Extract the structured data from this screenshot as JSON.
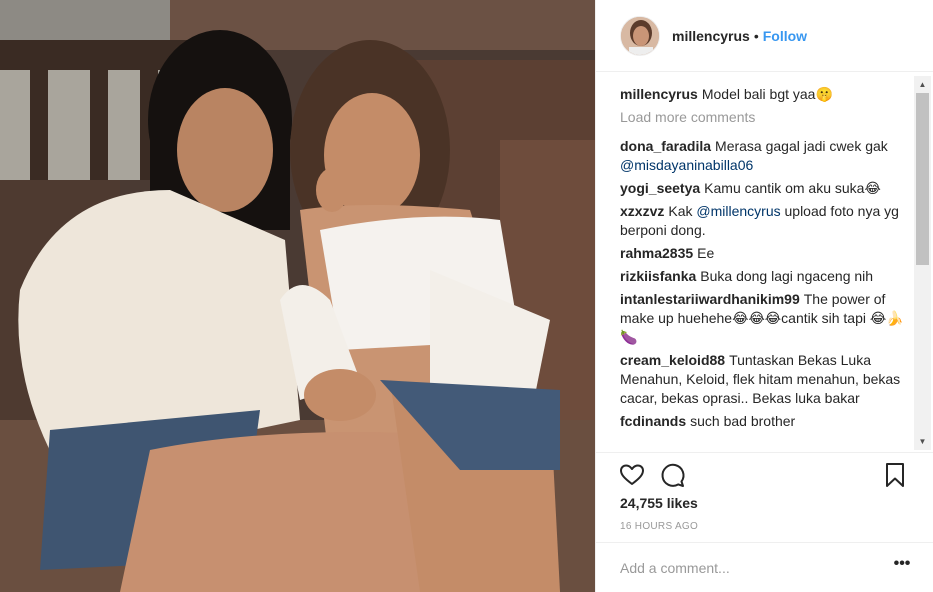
{
  "post": {
    "username": "millencyrus",
    "follow_label": "Follow",
    "separator": "•"
  },
  "caption": {
    "user": "millencyrus",
    "text": "Model bali bgt yaa🤫"
  },
  "load_more_label": "Load more comments",
  "comments": [
    {
      "user": "dona_faradila",
      "text": "Merasa gagal jadi cwek gak",
      "mention": "@misdayaninabilla06",
      "text_after": ""
    },
    {
      "user": "yogi_seetya",
      "text": "Kamu cantik om aku suka😂",
      "mention": "",
      "text_after": ""
    },
    {
      "user": "xzxzvz",
      "text": "Kak",
      "mention": "@millencyrus",
      "text_after": " upload foto nya yg berponi dong."
    },
    {
      "user": "rahma2835",
      "text": "Ee",
      "mention": "",
      "text_after": ""
    },
    {
      "user": "rizkiisfanka",
      "text": "Buka dong lagi ngaceng nih",
      "mention": "",
      "text_after": ""
    },
    {
      "user": "intanlestariiwardhanikim99",
      "text": "The power of make up huehehe😂😂😂cantik sih tapi 😂🍌🍆",
      "mention": "",
      "text_after": ""
    },
    {
      "user": "cream_keloid88",
      "text": "Tuntaskan Bekas Luka Menahun, Keloid, flek hitam menahun, bekas cacar, bekas oprasi.. Bekas luka bakar",
      "mention": "",
      "text_after": ""
    },
    {
      "user": "fcdinands",
      "text": "such bad brother",
      "mention": "",
      "text_after": ""
    }
  ],
  "likes_text": "24,755 likes",
  "time_text": "16 HOURS AGO",
  "add_comment_placeholder": "Add a comment...",
  "more_label": "•••",
  "icons": {
    "like": "heart-icon",
    "comment": "comment-icon",
    "save": "bookmark-icon",
    "more": "more-options-icon"
  },
  "colors": {
    "link": "#3897f0",
    "mention": "#003569",
    "muted": "#999999",
    "text": "#262626"
  }
}
